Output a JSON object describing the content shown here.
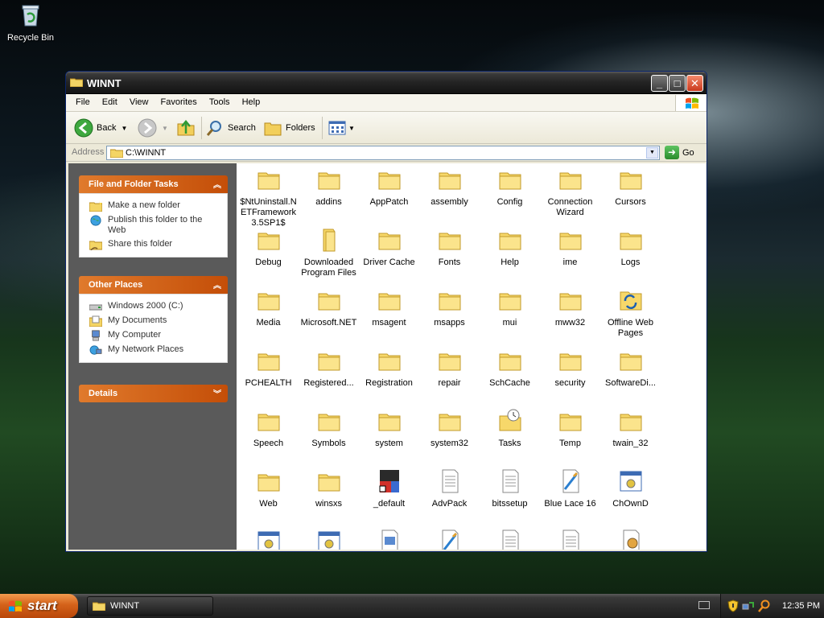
{
  "desktop": {
    "recycle_bin_label": "Recycle Bin"
  },
  "window": {
    "title": "WINNT",
    "menu": [
      "File",
      "Edit",
      "View",
      "Favorites",
      "Tools",
      "Help"
    ],
    "toolbar": {
      "back": "Back",
      "search": "Search",
      "folders": "Folders"
    },
    "address": {
      "label": "Address",
      "value": "C:\\WINNT",
      "go": "Go"
    }
  },
  "taskpane": {
    "file_tasks": {
      "title": "File and Folder Tasks",
      "items": [
        "Make a new folder",
        "Publish this folder to the Web",
        "Share this folder"
      ]
    },
    "other_places": {
      "title": "Other Places",
      "items": [
        "Windows 2000 (C:)",
        "My Documents",
        "My Computer",
        "My Network Places"
      ]
    },
    "details": {
      "title": "Details"
    }
  },
  "files": [
    {
      "name": "$NtUninstall.NETFramework3.5SP1$",
      "icon": "folder"
    },
    {
      "name": "addins",
      "icon": "folder"
    },
    {
      "name": "AppPatch",
      "icon": "folder"
    },
    {
      "name": "assembly",
      "icon": "folder"
    },
    {
      "name": "Config",
      "icon": "folder"
    },
    {
      "name": "Connection Wizard",
      "icon": "folder"
    },
    {
      "name": "Cursors",
      "icon": "folder"
    },
    {
      "name": "Debug",
      "icon": "folder"
    },
    {
      "name": "Downloaded Program Files",
      "icon": "folder-special"
    },
    {
      "name": "Driver Cache",
      "icon": "folder"
    },
    {
      "name": "Fonts",
      "icon": "folder"
    },
    {
      "name": "Help",
      "icon": "folder"
    },
    {
      "name": "ime",
      "icon": "folder"
    },
    {
      "name": "Logs",
      "icon": "folder"
    },
    {
      "name": "Media",
      "icon": "folder"
    },
    {
      "name": "Microsoft.NET",
      "icon": "folder"
    },
    {
      "name": "msagent",
      "icon": "folder"
    },
    {
      "name": "msapps",
      "icon": "folder"
    },
    {
      "name": "mui",
      "icon": "folder"
    },
    {
      "name": "mww32",
      "icon": "folder"
    },
    {
      "name": "Offline Web Pages",
      "icon": "offline-folder"
    },
    {
      "name": "PCHEALTH",
      "icon": "folder"
    },
    {
      "name": "Registered...",
      "icon": "folder"
    },
    {
      "name": "Registration",
      "icon": "folder"
    },
    {
      "name": "repair",
      "icon": "folder"
    },
    {
      "name": "SchCache",
      "icon": "folder"
    },
    {
      "name": "security",
      "icon": "folder"
    },
    {
      "name": "SoftwareDi...",
      "icon": "folder"
    },
    {
      "name": "Speech",
      "icon": "folder"
    },
    {
      "name": "Symbols",
      "icon": "folder"
    },
    {
      "name": "system",
      "icon": "folder"
    },
    {
      "name": "system32",
      "icon": "folder"
    },
    {
      "name": "Tasks",
      "icon": "tasks-folder"
    },
    {
      "name": "Temp",
      "icon": "folder"
    },
    {
      "name": "twain_32",
      "icon": "folder"
    },
    {
      "name": "Web",
      "icon": "folder"
    },
    {
      "name": "winsxs",
      "icon": "folder"
    },
    {
      "name": "_default",
      "icon": "ms-shortcut"
    },
    {
      "name": "AdvPack",
      "icon": "document"
    },
    {
      "name": "bitssetup",
      "icon": "document"
    },
    {
      "name": "Blue Lace 16",
      "icon": "bitmap"
    },
    {
      "name": "ChOwnD",
      "icon": "application"
    },
    {
      "name": "",
      "icon": "application"
    },
    {
      "name": "",
      "icon": "application"
    },
    {
      "name": "",
      "icon": "video"
    },
    {
      "name": "",
      "icon": "bitmap"
    },
    {
      "name": "",
      "icon": "document"
    },
    {
      "name": "",
      "icon": "document"
    },
    {
      "name": "",
      "icon": "settings-document"
    }
  ],
  "taskbar": {
    "start": "start",
    "task_button": "WINNT",
    "clock": "12:35 PM"
  }
}
